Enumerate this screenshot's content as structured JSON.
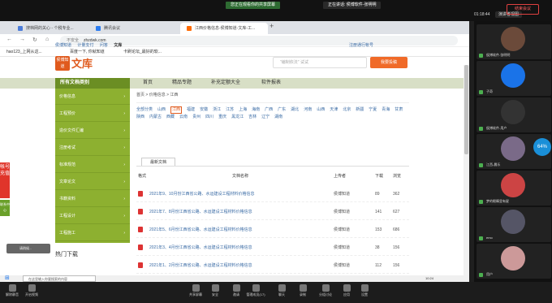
{
  "meeting_top": {
    "tag1": "您正在观看你的共享屏幕",
    "tag2": "正在讲话: 侯博软件-张明明",
    "time": "01:18:44",
    "view": "演讲者视图"
  },
  "tabs": [
    {
      "label": "搜档网的关心 - 个税专业..."
    },
    {
      "label": "腾讯会议"
    },
    {
      "label": "江西价格信息-侯博知道-文库-工..."
    }
  ],
  "address": {
    "notsecure": "不安全",
    "url": "zhzdwk.com"
  },
  "bookmarks": [
    {
      "label": "hao123_上网从这..."
    },
    {
      "label": "百度一下, 你就知道"
    },
    {
      "label": "卡刷论坛_最好的软..."
    }
  ],
  "site_nav": {
    "items": [
      "侯博知道",
      "计量支付",
      "问答",
      "文库"
    ],
    "right": "注册通行帐号"
  },
  "logo": {
    "box": "侯博知道",
    "text": "文库"
  },
  "search": {
    "placeholder": "\"编制依法\" 试试",
    "button": "我要投稿"
  },
  "catbar": {
    "all": "所有文档类别",
    "items": [
      "首页",
      "精品专题",
      "补充定额大全",
      "软件报表"
    ]
  },
  "side": [
    {
      "label": "价格信息"
    },
    {
      "label": "工程预价"
    },
    {
      "label": "造价文件汇编"
    },
    {
      "label": "注册考试"
    },
    {
      "label": "标准规范"
    },
    {
      "label": "文章论文"
    },
    {
      "label": "书籍资料"
    },
    {
      "label": "工程设计"
    },
    {
      "label": "工程施工"
    }
  ],
  "hot": "热门下载",
  "breadcrumb": "首页 > 价格信息 > 江西",
  "provinces": [
    "全部分类",
    "山西",
    "江西",
    "福建",
    "安徽",
    "浙江",
    "江苏",
    "上海",
    "海南",
    "广西",
    "广东",
    "湖北",
    "河南",
    "山西",
    "天津",
    "北京",
    "新疆",
    "宁夏",
    "青海",
    "甘肃",
    "陕西",
    "内蒙古",
    "西藏",
    "云南",
    "贵州",
    "四川",
    "重庆",
    "黑龙江",
    "吉林",
    "辽宁",
    "湖南"
  ],
  "latest_tab": "最新文档",
  "table": {
    "headers": [
      "格式",
      "文档名称",
      "上传者",
      "下载",
      "浏览"
    ],
    "rows": [
      {
        "title": "2021年9、10月份江西省公路、水运建设工程材料价格信息",
        "uploader": "侯博知道",
        "downloads": "89",
        "views": "362"
      },
      {
        "title": "2021年7、8月份江西省公路、水运建设工程材料价格信息",
        "uploader": "侯博知道",
        "downloads": "141",
        "views": "627"
      },
      {
        "title": "2021年5、6月份江西省公路、水运建设工程材料价格信息",
        "uploader": "侯博知道",
        "downloads": "153",
        "views": "686"
      },
      {
        "title": "2021年3、4月份江西省公路、水运建设工程材料价格信息",
        "uploader": "侯博知道",
        "downloads": "38",
        "views": "156"
      },
      {
        "title": "2021年1、2月份江西省公路、水运建设工程材料价格信息",
        "uploader": "侯博知道",
        "downloads": "112",
        "views": "156"
      }
    ]
  },
  "redtab": "帐号充值",
  "greentab": "联系中心",
  "progress": "请稍候...",
  "taskbar": {
    "search": "在这里输入你要搜索的内容",
    "time": "10:24"
  },
  "meetbar": [
    {
      "label": "解除静音"
    },
    {
      "label": "开启视频"
    },
    {
      "label": "共享屏幕"
    },
    {
      "label": "安全"
    },
    {
      "label": "邀请"
    },
    {
      "label": "管理成员(17)"
    },
    {
      "label": "聊天"
    },
    {
      "label": "录制"
    },
    {
      "label": "分组讨论"
    },
    {
      "label": "应用"
    },
    {
      "label": "设置"
    }
  ],
  "end_button": "结束会议",
  "participants": [
    {
      "name": "侯博软件-张明明"
    },
    {
      "name": "子奇"
    },
    {
      "name": "侯博软件-用户"
    },
    {
      "name": "江西-晨乐"
    },
    {
      "name": "梦的眼睛里有星"
    },
    {
      "name": "emo"
    },
    {
      "name": "用户"
    }
  ],
  "participant_percent": "64%"
}
